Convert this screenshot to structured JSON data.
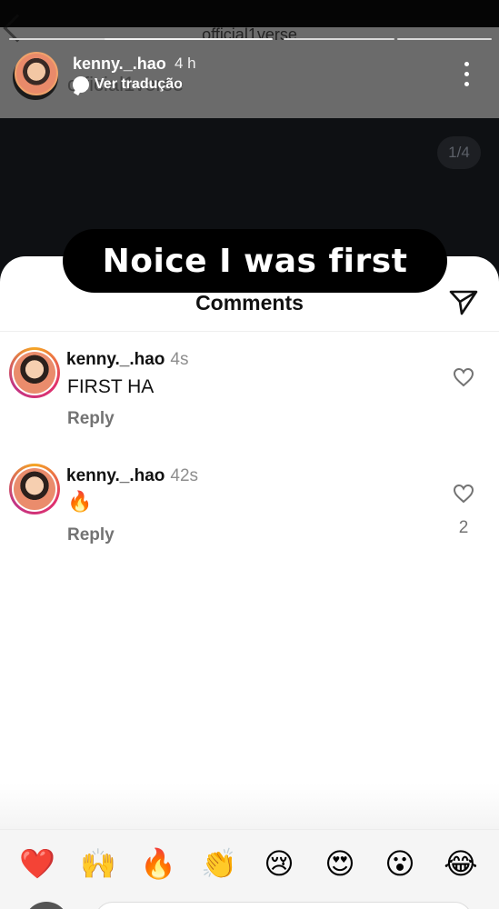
{
  "story": {
    "background_name": "official1verse",
    "ghost_text": "official1verse",
    "username": "kenny._.hao",
    "time": "4 h",
    "translate_label": "Ver tradução",
    "page_indicator": "1/4",
    "progress_segments": 4
  },
  "caption": {
    "text": "Noice I was first"
  },
  "sheet": {
    "title": "Comments"
  },
  "comments": [
    {
      "username": "kenny._.hao",
      "time": "4s",
      "text": "FIRST HA",
      "reply_label": "Reply",
      "likes": ""
    },
    {
      "username": "kenny._.hao",
      "time": "42s",
      "text": "🔥",
      "reply_label": "Reply",
      "likes": "2"
    }
  ],
  "reactions": [
    "❤️",
    "🙌",
    "🔥",
    "👏",
    "😢",
    "😍",
    "😮",
    "😂"
  ],
  "icons": {
    "send": "send-icon",
    "heart": "heart-outline-icon",
    "more": "more-vertical-icon",
    "translate": "translate-icon",
    "back": "back-arrow-icon"
  }
}
